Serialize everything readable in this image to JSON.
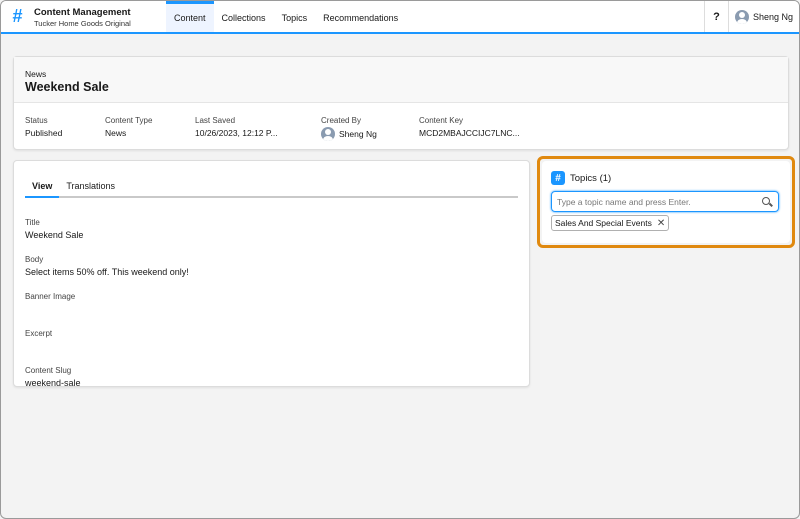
{
  "header": {
    "app_icon": "#",
    "app_name": "Content Management",
    "app_subtitle": "Tucker Home Goods Original",
    "tabs": [
      {
        "label": "Content",
        "active": true
      },
      {
        "label": "Collections",
        "active": false
      },
      {
        "label": "Topics",
        "active": false
      },
      {
        "label": "Recommendations",
        "active": false
      }
    ],
    "help_label": "?",
    "user_name": "Sheng Ng"
  },
  "record": {
    "type": "News",
    "title": "Weekend Sale",
    "fields": [
      {
        "label": "Status",
        "value": "Published"
      },
      {
        "label": "Content Type",
        "value": "News"
      },
      {
        "label": "Last Saved",
        "value": "10/26/2023, 12:12 P..."
      },
      {
        "label": "Created By",
        "value": "Sheng Ng"
      },
      {
        "label": "Content Key",
        "value": "MCD2MBAJCCIJC7LNC..."
      }
    ]
  },
  "main": {
    "tabs": [
      {
        "label": "View",
        "active": true
      },
      {
        "label": "Translations",
        "active": false
      }
    ],
    "fields": [
      {
        "label": "Title",
        "value": "Weekend Sale"
      },
      {
        "label": "Body",
        "value": "Select items 50% off. This weekend only!"
      },
      {
        "label": "Banner Image",
        "value": ""
      },
      {
        "label": "Excerpt",
        "value": ""
      },
      {
        "label": "Content Slug",
        "value": "weekend-sale"
      }
    ]
  },
  "topics": {
    "title": "Topics (1)",
    "icon": "#",
    "input_placeholder": "Type a topic name and press Enter.",
    "assigned": [
      "Sales And Special Events"
    ],
    "remove_glyph": "✕"
  },
  "colors": {
    "accent": "#1b96ff",
    "highlight": "#e0890f"
  }
}
